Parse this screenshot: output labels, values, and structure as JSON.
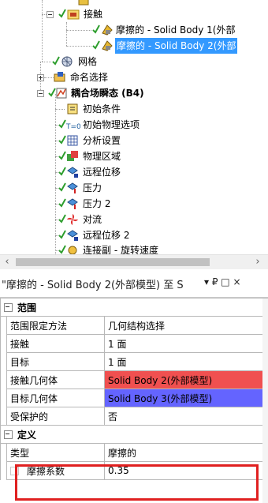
{
  "tree": {
    "items": [
      {
        "label": "接触"
      },
      {
        "label": "摩擦的 - Solid Body 1(外部"
      },
      {
        "label": "摩擦的 - Solid Body 2(外部"
      },
      {
        "label": "网格"
      },
      {
        "label": "命名选择"
      },
      {
        "label": "耦合场瞬态 (B4)"
      },
      {
        "label": "初始条件"
      },
      {
        "label": "初始物理选项"
      },
      {
        "label": "分析设置"
      },
      {
        "label": "物理区域"
      },
      {
        "label": "远程位移"
      },
      {
        "label": "压力"
      },
      {
        "label": "压力 2"
      },
      {
        "label": "对流"
      },
      {
        "label": "远程位移 2"
      },
      {
        "label": "连接副 - 旋转速度"
      }
    ]
  },
  "details": {
    "title": "\"摩擦的 - Solid Body 2(外部模型) 至 S",
    "pin": "▾  ₽ □ ×",
    "sections": [
      {
        "name": "范围",
        "rows": [
          {
            "key": "范围限定方法",
            "value": "几何结构选择"
          },
          {
            "key": "接触",
            "value": "1 面"
          },
          {
            "key": "目标",
            "value": "1 面"
          },
          {
            "key": "接触几何体",
            "value": "Solid Body 2(外部模型)"
          },
          {
            "key": "目标几何体",
            "value": "Solid Body 3(外部模型)"
          },
          {
            "key": "受保护的",
            "value": "否"
          }
        ]
      },
      {
        "name": "定义",
        "rows": [
          {
            "key": "类型",
            "value": "摩擦的"
          },
          {
            "key": "摩擦系数",
            "value": "0.35"
          }
        ]
      }
    ]
  },
  "colors": {
    "selection": "#3399ff",
    "contact_body": "#f05050",
    "target_body": "#6464ff",
    "highlight_box": "#e02020"
  }
}
